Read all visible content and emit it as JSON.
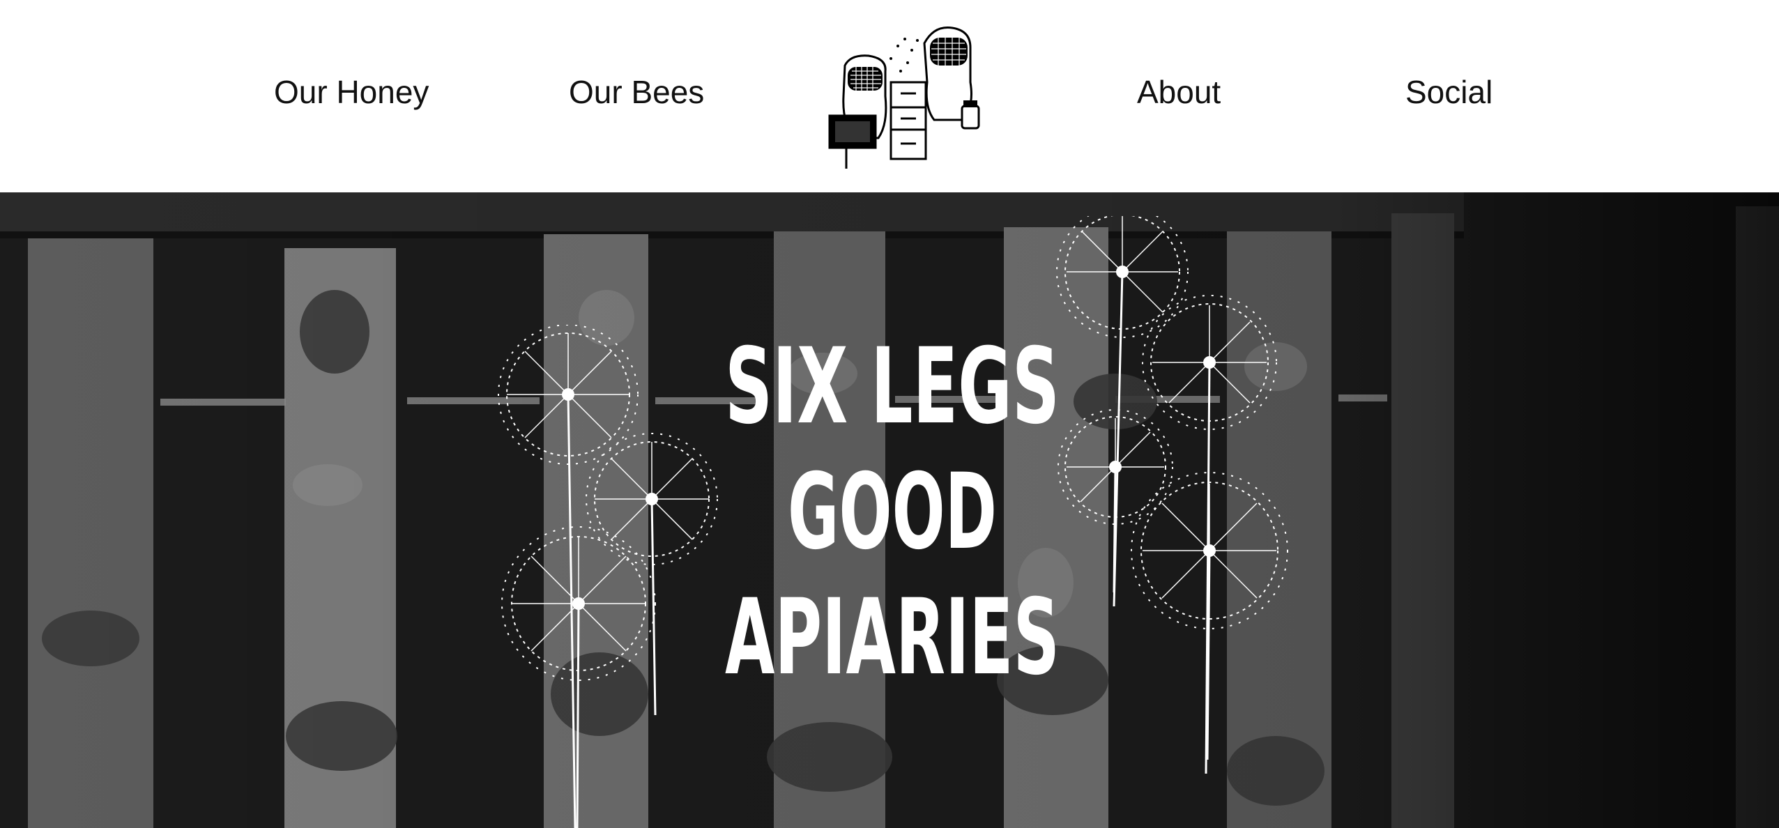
{
  "nav": {
    "left": [
      {
        "label": "Our Honey"
      },
      {
        "label": "Our Bees"
      }
    ],
    "right": [
      {
        "label": "About"
      },
      {
        "label": "Social"
      }
    ],
    "logo_icon": "beekeepers-logo-icon"
  },
  "hero": {
    "title_lines": [
      "SIX LEGS",
      "GOOD",
      "APIARIES"
    ],
    "background_icon": "beehive-frames-photo",
    "decoration_icon": "dandelion-icon",
    "colors": {
      "background": "#1a1a1a",
      "text": "#ffffff"
    }
  }
}
